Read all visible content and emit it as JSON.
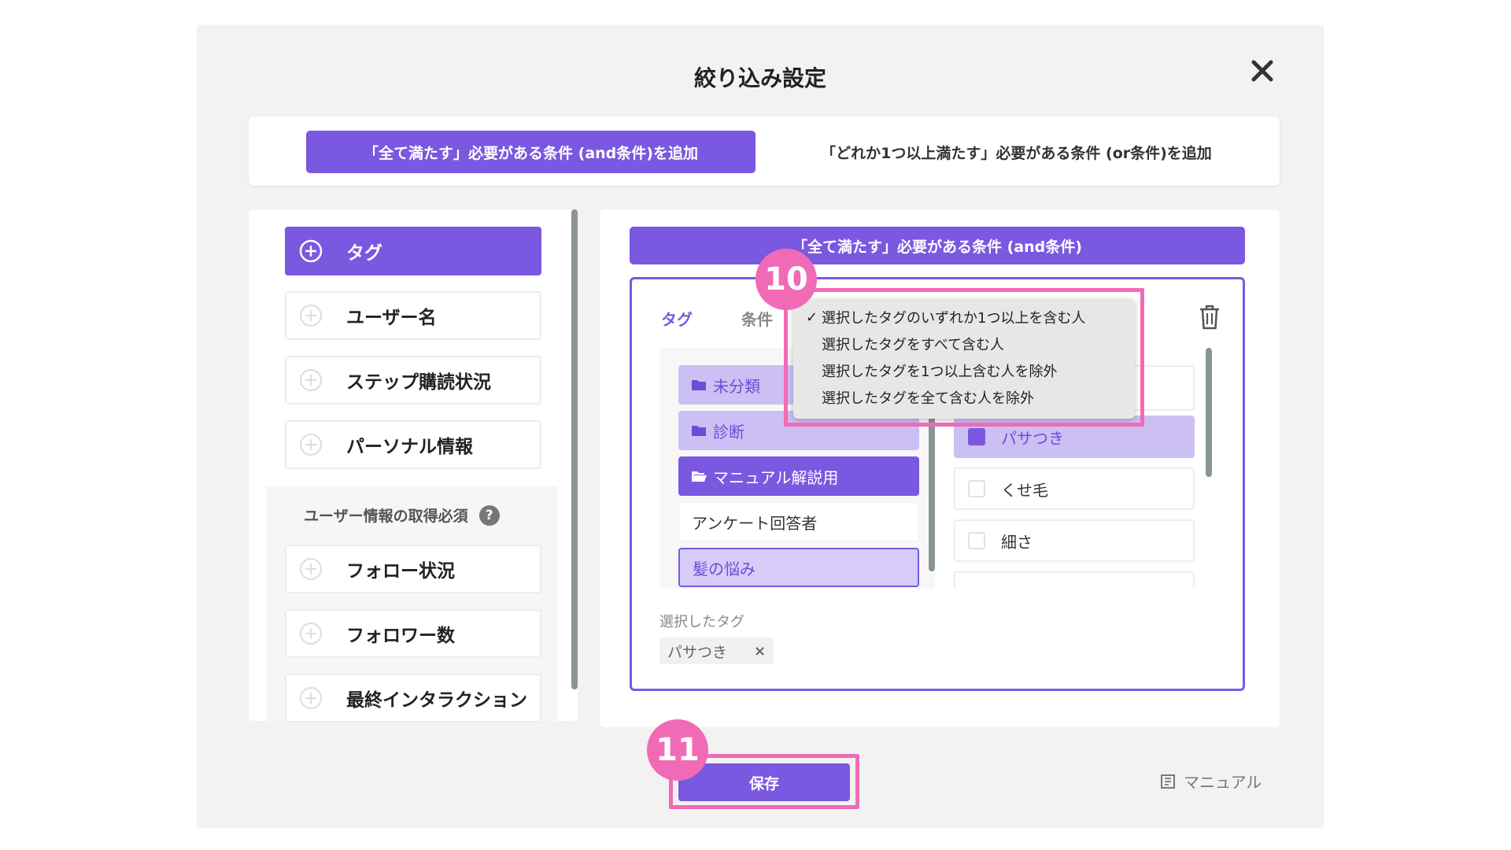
{
  "modal": {
    "title": "絞り込み設定"
  },
  "mode_bar": {
    "and_label": "「全て満たす」必要がある条件 (and条件)を追加",
    "or_label": "「どれか1つ以上満たす」必要がある条件 (or条件)を追加"
  },
  "left_panel": {
    "items": [
      "タグ",
      "ユーザー名",
      "ステップ購読状況",
      "パーソナル情報"
    ],
    "section_title": "ユーザー情報の取得必須",
    "help": "?",
    "section_items": [
      "フォロー状況",
      "フォロワー数",
      "最終インタラクション"
    ]
  },
  "right_panel": {
    "header": "「全て満たす」必要がある条件 (and条件)",
    "tab_tag": "タグ",
    "tab_condition": "条件",
    "tree": [
      "未分類",
      "診断",
      "マニュアル解説用",
      "アンケート回答者",
      "髪の悩み"
    ],
    "options": [
      "パサつき",
      "くせ毛",
      "細さ"
    ],
    "selected_label": "選択したタグ",
    "selected_chip": "パサつき",
    "chip_remove": "×"
  },
  "dropdown": {
    "check": "✓",
    "items": [
      "選択したタグのいずれか1つ以上を含む人",
      "選択したタグをすべて含む人",
      "選択したタグを1つ以上含む人を除外",
      "選択したタグを全て含む人を除外"
    ]
  },
  "badges": {
    "step10": "10",
    "step11": "11"
  },
  "footer": {
    "save": "保存",
    "manual": "マニュアル"
  },
  "colors": {
    "accent": "#7a58e0",
    "highlight": "#f06ab6"
  }
}
